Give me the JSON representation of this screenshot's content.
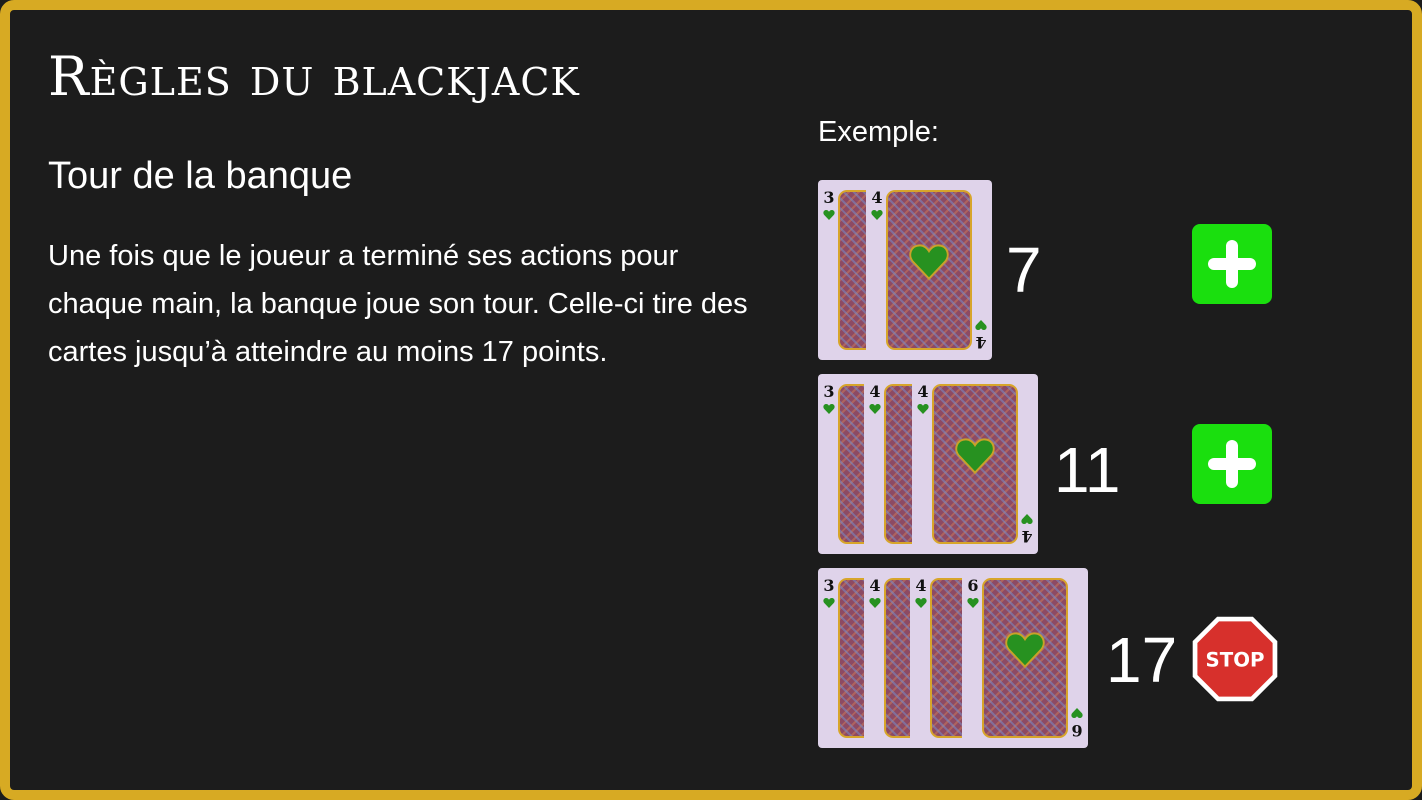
{
  "title": "Règles du blackjack",
  "subtitle": "Tour de la banque",
  "body": "Une fois que le joueur a terminé ses actions pour chaque main, la banque joue son tour. Celle-ci tire des cartes jusqu’à atteindre au moins 17 points.",
  "example_label": "Exemple:",
  "colors": {
    "background": "#1c1c1c",
    "border": "#d7aa23",
    "card_face": "#dfd3ea",
    "heart": "#279120",
    "hit_button": "#1adf0e",
    "stop": "#d7302c"
  },
  "hands": [
    {
      "cards": [
        "3",
        "4"
      ],
      "total": "7",
      "action": "hit",
      "action_icon": "plus-icon"
    },
    {
      "cards": [
        "3",
        "4",
        "4"
      ],
      "total": "11",
      "action": "hit",
      "action_icon": "plus-icon"
    },
    {
      "cards": [
        "3",
        "4",
        "4",
        "6"
      ],
      "total": "17",
      "action": "stop",
      "action_icon": "stop-sign-icon",
      "stop_label": "STOP"
    }
  ]
}
